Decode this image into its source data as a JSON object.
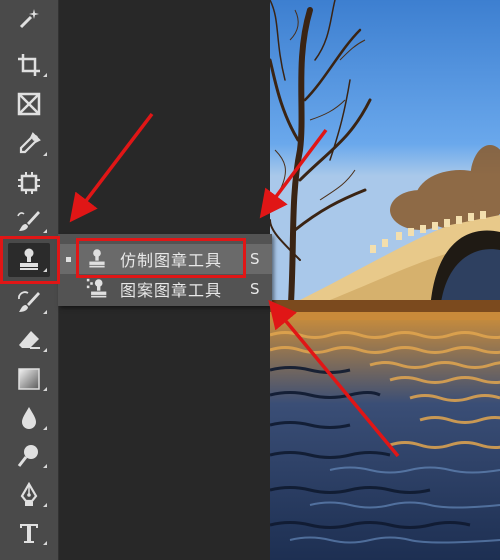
{
  "toolbar": {
    "tools": [
      {
        "name": "magic-wand-tool",
        "icon": "magic-wand-icon"
      },
      {
        "name": "crop-tool",
        "icon": "crop-icon"
      },
      {
        "name": "frame-tool",
        "icon": "frame-icon"
      },
      {
        "name": "eyedropper-tool",
        "icon": "eyedropper-icon"
      },
      {
        "name": "spot-healing-tool",
        "icon": "spot-healing-icon"
      },
      {
        "name": "brush-tool",
        "icon": "brush-icon"
      },
      {
        "name": "clone-stamp-tool",
        "icon": "stamp-icon",
        "active": true
      },
      {
        "name": "history-brush-tool",
        "icon": "history-brush-icon"
      },
      {
        "name": "eraser-tool",
        "icon": "eraser-icon"
      },
      {
        "name": "gradient-tool",
        "icon": "gradient-icon"
      },
      {
        "name": "blur-tool",
        "icon": "drop-icon"
      },
      {
        "name": "dodge-tool",
        "icon": "dodge-icon"
      },
      {
        "name": "pen-tool",
        "icon": "pen-icon"
      },
      {
        "name": "type-tool",
        "icon": "type-icon"
      }
    ]
  },
  "flyout": {
    "items": [
      {
        "label": "仿制图章工具",
        "shortcut": "S",
        "selected": true,
        "icon": "stamp-icon"
      },
      {
        "label": "图案图章工具",
        "shortcut": "S",
        "selected": false,
        "icon": "pattern-stamp-icon"
      }
    ]
  },
  "colors": {
    "annotation_red": "#e01616",
    "toolbar_bg": "#4a4a4a",
    "workspace_bg": "#282828"
  }
}
